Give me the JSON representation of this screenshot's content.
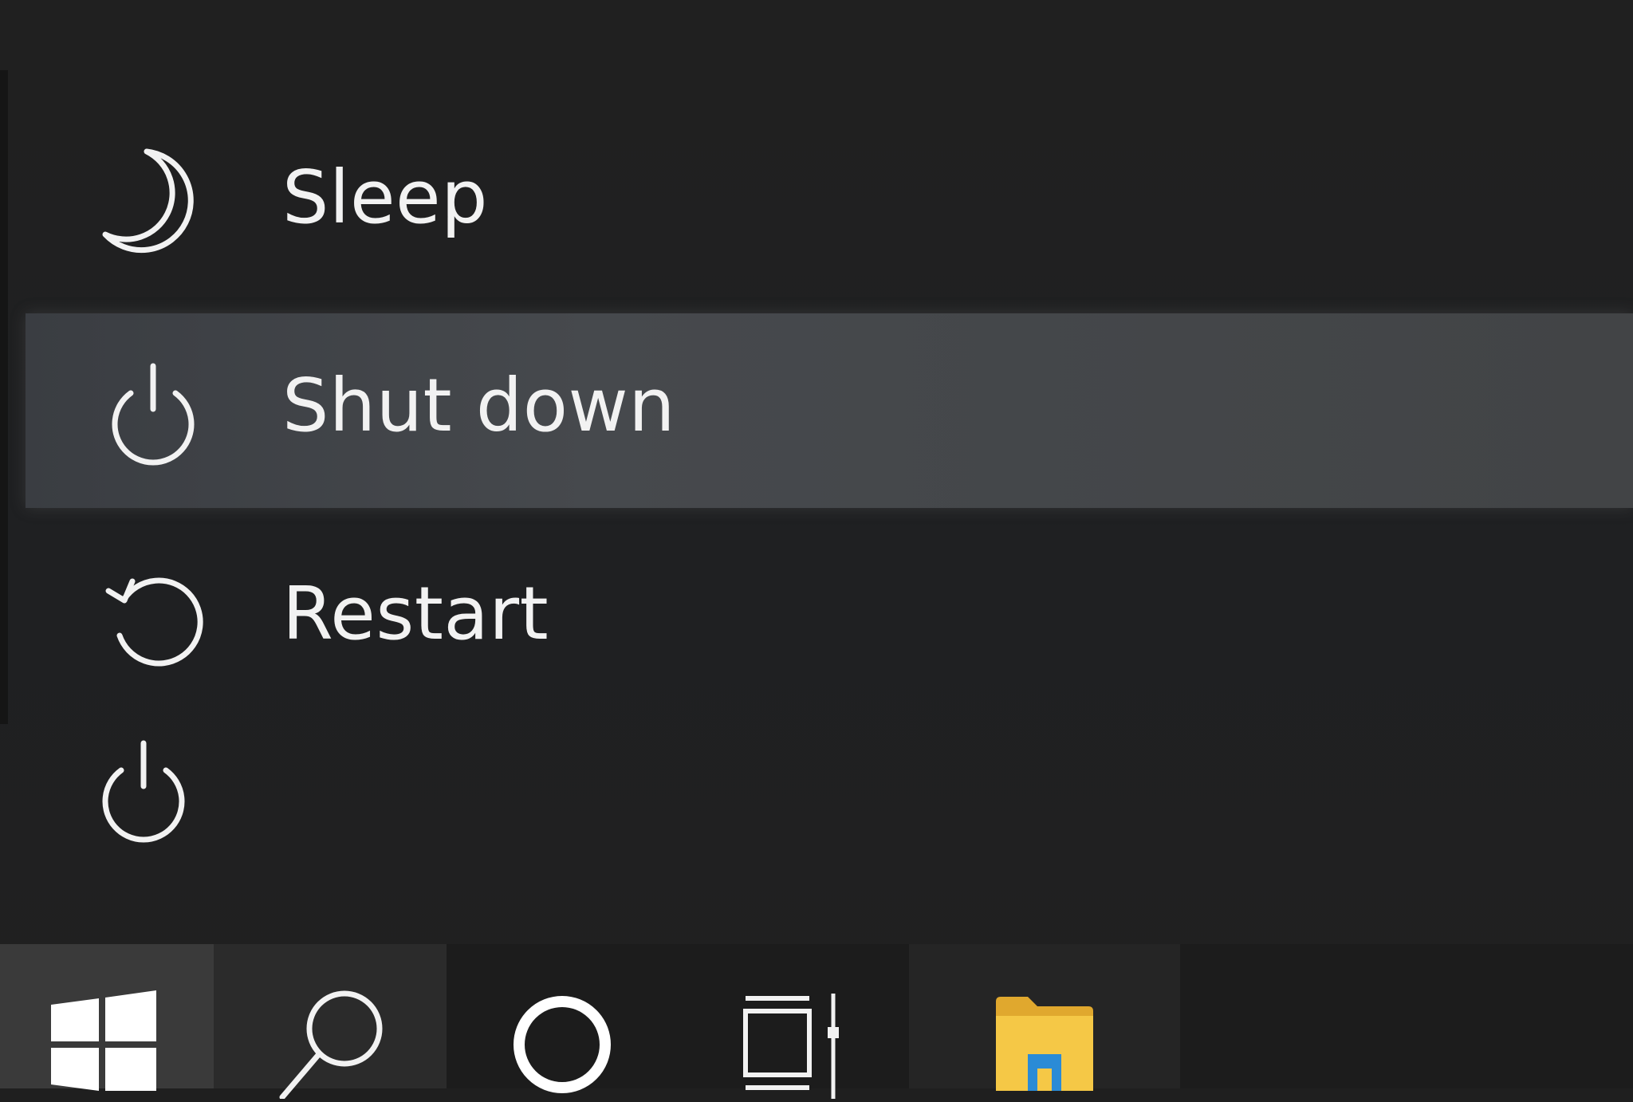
{
  "power_menu": {
    "items": [
      {
        "label": "Sleep",
        "icon": "moon-icon"
      },
      {
        "label": "Shut down",
        "icon": "power-icon",
        "highlighted": true
      },
      {
        "label": "Restart",
        "icon": "restart-icon"
      }
    ]
  },
  "power_button": {
    "icon": "power-icon"
  },
  "taskbar": {
    "items": [
      {
        "icon": "windows-logo-icon"
      },
      {
        "icon": "search-icon"
      },
      {
        "icon": "cortana-icon"
      },
      {
        "icon": "task-view-icon"
      },
      {
        "icon": "file-explorer-icon"
      }
    ]
  },
  "colors": {
    "background": "#202020",
    "highlight": "#45474a",
    "text": "#f2f2f2",
    "taskbar": "#1c1c1c",
    "folder": "#f0c23c",
    "folder_accent": "#2a8bd6"
  }
}
